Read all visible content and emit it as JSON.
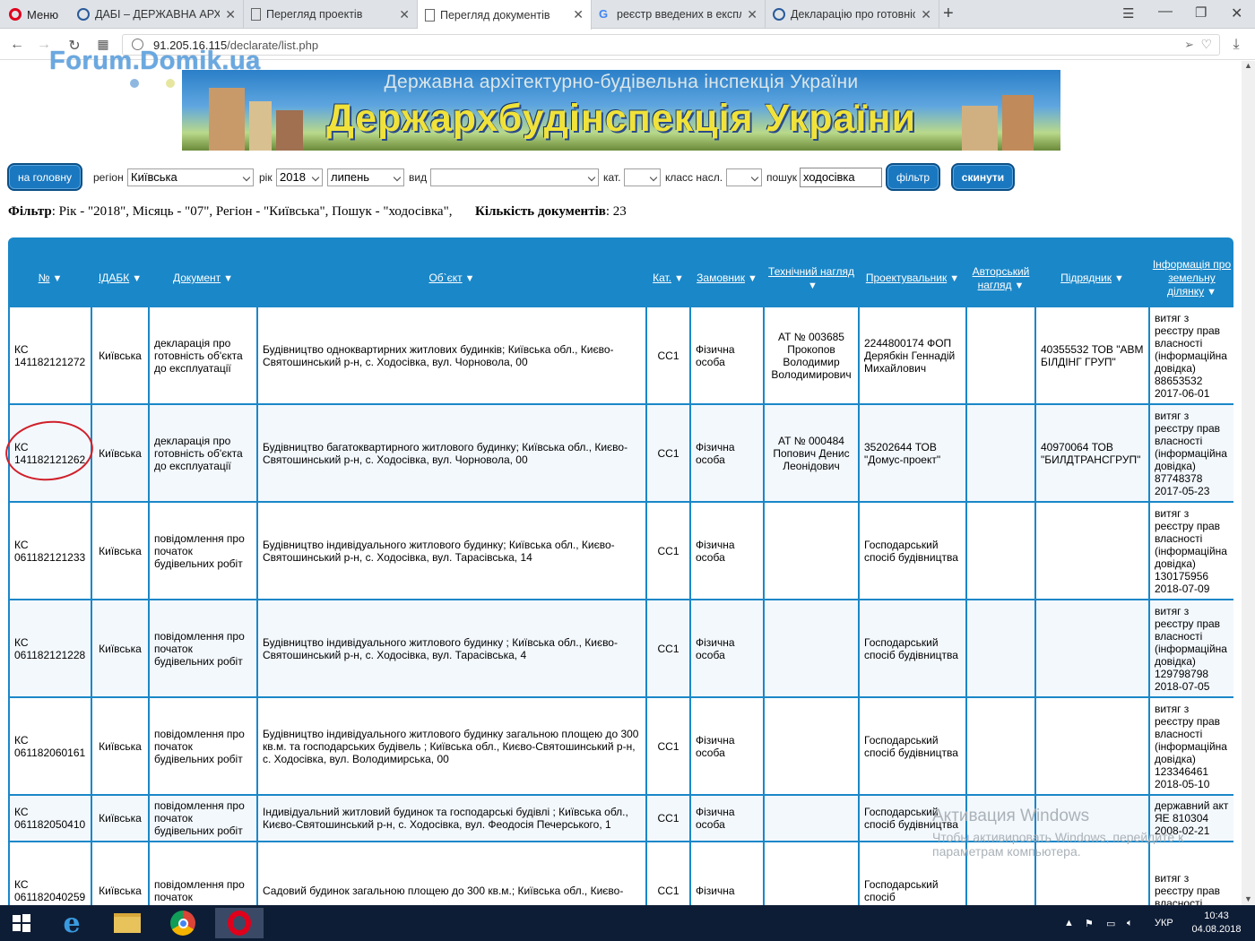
{
  "browser": {
    "menu_label": "Меню",
    "tabs": [
      {
        "title": "ДАБІ – ДЕРЖАВНА АРХІТЕ",
        "active": false
      },
      {
        "title": "Перегляд проектів",
        "active": false
      },
      {
        "title": "Перегляд документів",
        "active": true
      },
      {
        "title": "реєстр введених в експлу",
        "active": false
      },
      {
        "title": "Декларацію про готовніс",
        "active": false
      }
    ],
    "url_host": "91.205.16.115",
    "url_path": "/declarate/list.php"
  },
  "watermark": "Forum.Domik.ua",
  "banner": {
    "line1": "Державна архітектурно-будівельна інспекція України",
    "line2": "Держархбудінспекція України"
  },
  "filters": {
    "home_button": "на головну",
    "region_label": "регіон",
    "region_value": "Київська",
    "year_label": "рік",
    "year_value": "2018",
    "month_value": "липень",
    "type_label": "вид",
    "type_value": "",
    "cat_label": "кат.",
    "cat_value": "",
    "class_label": "класс насл.",
    "class_value": "",
    "search_label": "пошук",
    "search_value": "ходосівка",
    "filter_button": "фільтр",
    "reset_button": "скинути"
  },
  "summary": {
    "filter_label": "Фільтр",
    "filter_text": ": Рік - \"2018\", Місяць - \"07\", Регіон - \"Київська\", Пошук - \"ходосівка\",",
    "count_label": "Кількість документів",
    "count_value": ": 23"
  },
  "table": {
    "columns": [
      "№",
      "ІДАБК",
      "Документ",
      "Об`єкт",
      "Кат.",
      "Замовник",
      "Технічний нагляд",
      "Проектувальник",
      "Авторський нагляд",
      "Підрядник",
      "Інформація про земельну ділянку"
    ],
    "rows": [
      [
        "КС 141182121272",
        "Київська",
        "декларація про готовність об'єкта до експлуатації",
        "Будівництво одноквартирних житлових будинків; Київська обл., Києво-Святошинський р-н, с. Ходосівка, вул. Чорновола, 00",
        "СС1",
        "Фізична особа",
        "АТ № 003685 Прокопов Володимир Володимирович",
        "2244800174 ФОП Дерябкін Геннадій Михайлович",
        "",
        "40355532 ТОВ \"АВМ БІЛДІНГ ГРУП\"",
        "витяг з реєстру прав власності (інформаційна довідка) 88653532 2017-06-01"
      ],
      [
        "КС 141182121262",
        "Київська",
        "декларація про готовність об'єкта до експлуатації",
        "Будівництво багатоквартирного житлового будинку; Київська обл., Києво-Святошинський р-н, с. Ходосівка, вул. Чорновола, 00",
        "СС1",
        "Фізична особа",
        "АТ № 000484 Попович Денис Леонідович",
        "35202644 ТОВ \"Домус-проект\"",
        "",
        "40970064 ТОВ \"БИЛДТРАНСГРУП\"",
        "витяг з реєстру прав власності (інформаційна довідка) 87748378 2017-05-23"
      ],
      [
        "КС 061182121233",
        "Київська",
        "повідомлення про початок будівельних робіт",
        "Будівництво індивідуального житлового будинку; Київська обл., Києво-Святошинський р-н, с. Ходосівка, вул. Тарасівська, 14",
        "СС1",
        "Фізична особа",
        "",
        "Господарський спосіб будівництва",
        "",
        "",
        "витяг з реєстру прав власності (інформаційна довідка) 130175956 2018-07-09"
      ],
      [
        "КС 061182121228",
        "Київська",
        "повідомлення про початок будівельних робіт",
        "Будівництво індивідуального житлового будинку ; Київська обл., Києво-Святошинський р-н, с. Ходосівка, вул. Тарасівська, 4",
        "СС1",
        "Фізична особа",
        "",
        "Господарський спосіб будівництва",
        "",
        "",
        "витяг з реєстру прав власності (інформаційна довідка) 129798798 2018-07-05"
      ],
      [
        "КС 061182060161",
        "Київська",
        "повідомлення про початок будівельних робіт",
        "Будівництво індивідуального житлового будинку загальною площею до 300 кв.м. та господарських будівель ; Київська обл., Києво-Святошинський р-н, с. Ходосівка, вул. Володимирська, 00",
        "СС1",
        "Фізична особа",
        "",
        "Господарський спосіб будівництва",
        "",
        "",
        "витяг з реєстру прав власності (інформаційна довідка) 123346461 2018-05-10"
      ],
      [
        "КС 061182050410",
        "Київська",
        "повідомлення про початок будівельних робіт",
        "Індивідуальний житловий будинок та господарські будівлі ; Київська обл., Києво-Святошинський р-н, с. Ходосівка, вул. Феодосія Печерського, 1",
        "СС1",
        "Фізична особа",
        "",
        "Господарський спосіб будівництва",
        "",
        "",
        "державний акт ЯЕ 810304 2008-02-21"
      ],
      [
        "КС 061182040259",
        "Київська",
        "повідомлення про початок",
        "Садовий будинок загальною площею до 300 кв.м.; Київська обл., Києво-",
        "СС1",
        "Фізична",
        "",
        "Господарський спосіб",
        "",
        "",
        "витяг з реєстру прав власності"
      ]
    ]
  },
  "activation": {
    "line1": "Активация Windows",
    "line2": "Чтобы активировать Windows, перейдите к",
    "line3": "параметрам компьютера."
  },
  "taskbar": {
    "lang": "УКР",
    "time": "10:43",
    "date": "04.08.2018"
  },
  "colors": {
    "accent": "#1a87c8",
    "button": "#1a78c0",
    "taskbar": "#0e1d36",
    "banner_text": "#f0e23a",
    "highlight": "#d0202a"
  }
}
